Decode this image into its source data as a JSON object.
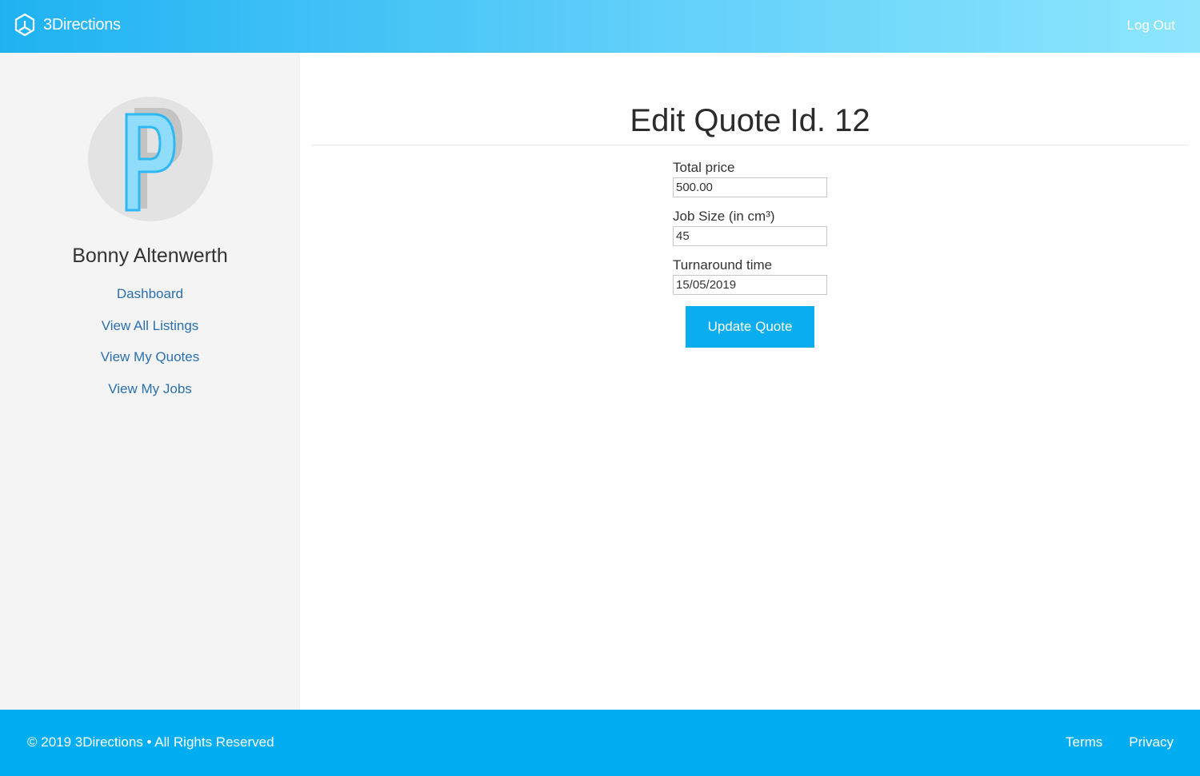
{
  "header": {
    "brand_name": "3Directions",
    "brand_icon": "cube-logo-icon",
    "logout_label": "Log Out"
  },
  "sidebar": {
    "avatar_icon": "letter-p-avatar-icon",
    "user_name": "Bonny Altenwerth",
    "nav_items": [
      {
        "label": "Dashboard"
      },
      {
        "label": "View All Listings"
      },
      {
        "label": "View My Quotes"
      },
      {
        "label": "View My Jobs"
      }
    ]
  },
  "main": {
    "title": "Edit Quote Id. 12",
    "form": {
      "total_price_label": "Total price",
      "total_price_value": "500.00",
      "job_size_label": "Job Size (in cm³)",
      "job_size_value": "45",
      "turnaround_label": "Turnaround time",
      "turnaround_value": "15/05/2019",
      "submit_label": "Update Quote"
    }
  },
  "footer": {
    "copyright": "© 2019 3Directions • All Rights Reserved",
    "links": [
      {
        "label": "Terms"
      },
      {
        "label": "Privacy"
      }
    ]
  },
  "colors": {
    "primary": "#03adf2",
    "header_gradient_start": "#1fb2f2",
    "header_gradient_end": "#8ee6fd",
    "link": "#2a6fad",
    "sidebar_bg": "#f4f4f4"
  }
}
